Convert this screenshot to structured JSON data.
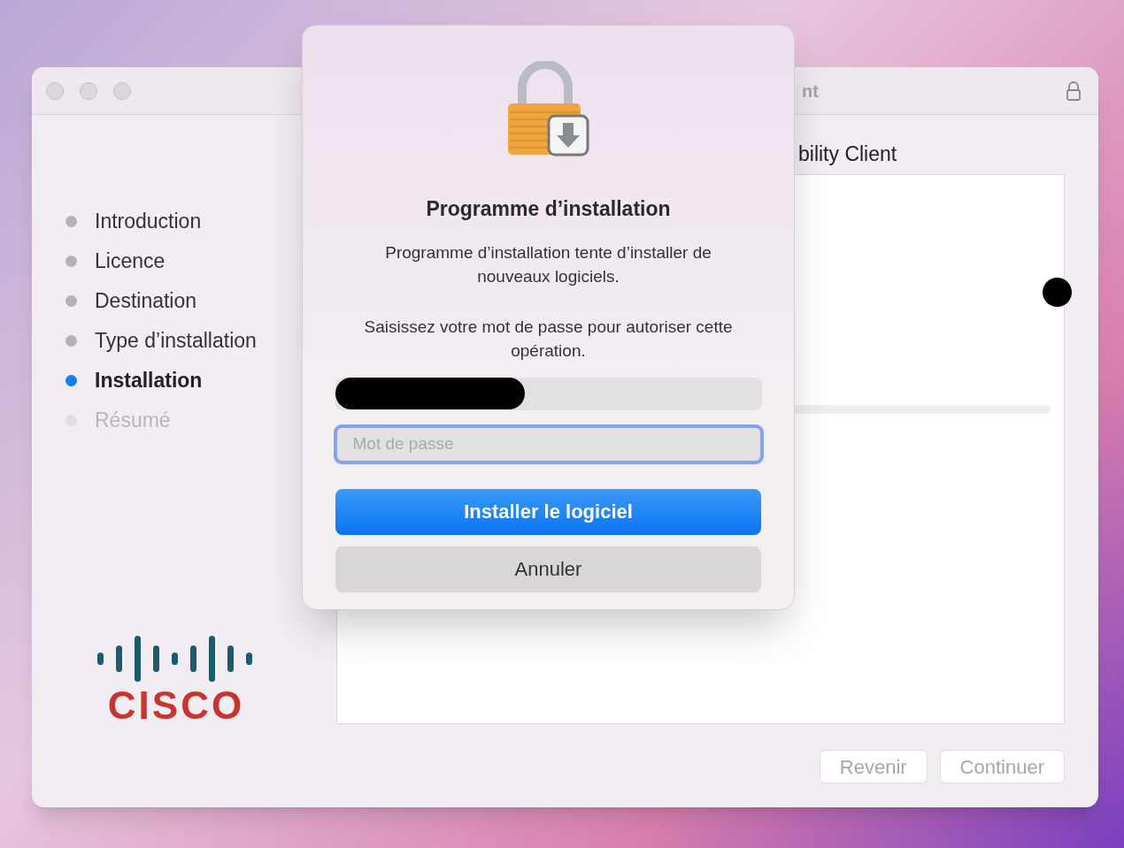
{
  "window": {
    "title": "nt",
    "heading": "bility Client"
  },
  "steps": [
    {
      "label": "Introduction",
      "selected": false,
      "disabled": false
    },
    {
      "label": "Licence",
      "selected": false,
      "disabled": false
    },
    {
      "label": "Destination",
      "selected": false,
      "disabled": false
    },
    {
      "label": "Type d’installation",
      "selected": false,
      "disabled": false
    },
    {
      "label": "Installation",
      "selected": true,
      "disabled": false
    },
    {
      "label": "Résumé",
      "selected": false,
      "disabled": true
    }
  ],
  "logo_text": "CISCO",
  "footer_buttons": [
    {
      "label": "Revenir",
      "disabled": true
    },
    {
      "label": "Continuer",
      "disabled": true
    }
  ],
  "dialog": {
    "title": "Programme d’installation",
    "message": "Programme d’installation tente d’installer de nouveaux logiciels.",
    "prompt": "Saisissez votre mot de passe pour autoriser cette opération.",
    "password": {
      "placeholder": "Mot de passe",
      "focused": true
    },
    "buttons": [
      {
        "label": "Installer le logiciel",
        "kind": "primary"
      },
      {
        "label": "Annuler",
        "kind": "secondary"
      }
    ]
  }
}
